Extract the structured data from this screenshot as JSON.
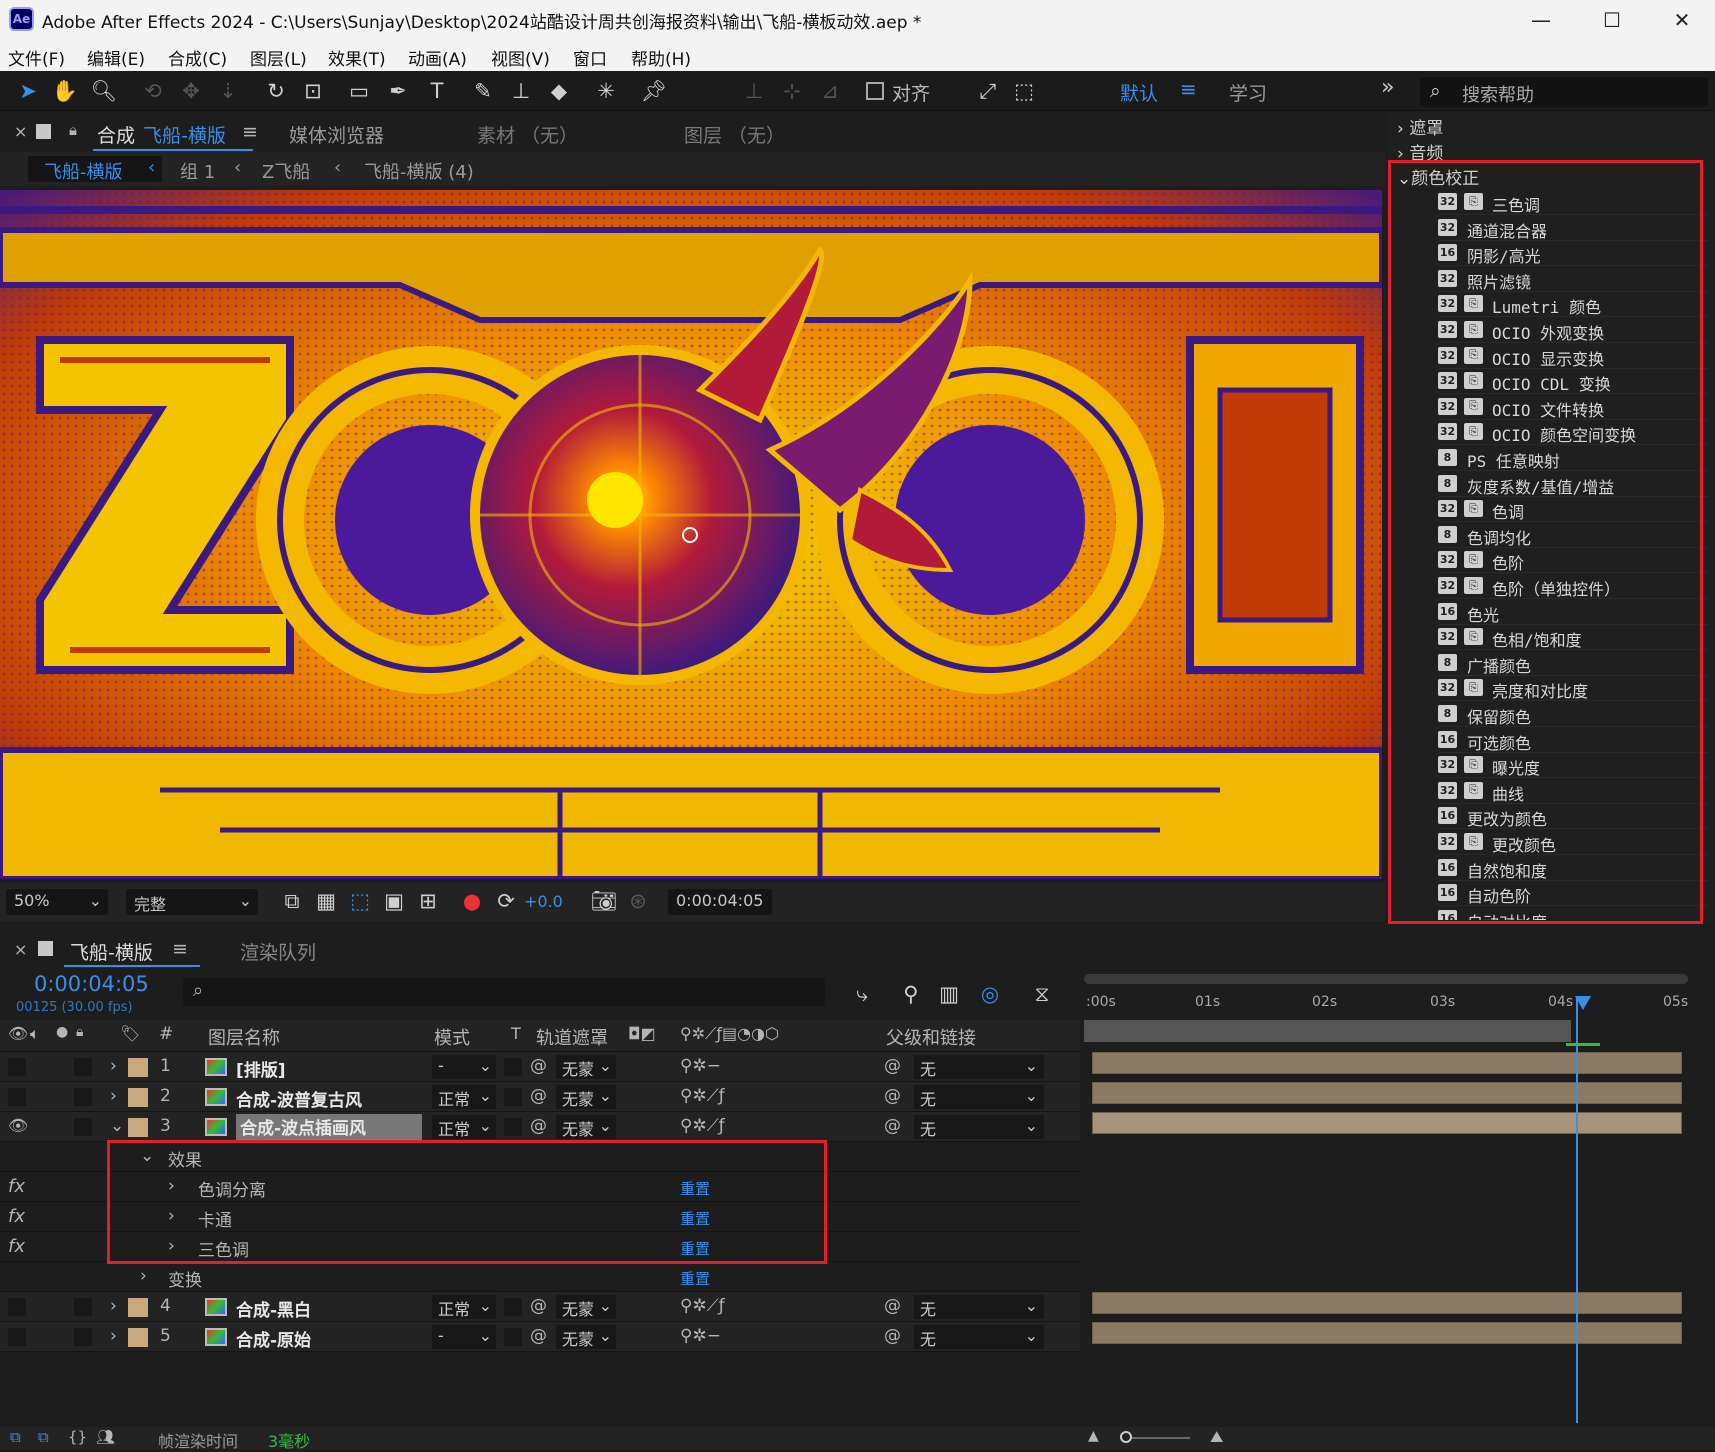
{
  "app": {
    "icon_label": "Ae",
    "title": "Adobe After Effects 2024 - C:\\Users\\Sunjay\\Desktop\\2024站酷设计周共创海报资料\\输出\\飞船-横板动效.aep *",
    "window_controls": {
      "minimize": "—",
      "maximize": "☐",
      "close": "✕"
    }
  },
  "menu": [
    "文件(F)",
    "编辑(E)",
    "合成(C)",
    "图层(L)",
    "效果(T)",
    "动画(A)",
    "视图(V)",
    "窗口",
    "帮助(H)"
  ],
  "toolbar": {
    "snap_label": "对齐",
    "workspace_default": "默认",
    "workspace_learn": "学习",
    "more": "»",
    "search_placeholder": "搜索帮助"
  },
  "comp_panel": {
    "close": "×",
    "tab_prefix": "合成",
    "tab_comp_name": "飞船-横版",
    "tab_menu": "≡",
    "tab_media": "媒体浏览器",
    "tab_footage": "素材 （无）",
    "tab_layer": "图层 （无）",
    "breadcrumbs": [
      "飞船-横版",
      "组 1",
      "Z飞船",
      "飞船-横版 (4)"
    ],
    "breadcrumb_sep": "‹"
  },
  "viewer_bar": {
    "zoom": "50%",
    "resolution": "完整",
    "exposure": "+0.0",
    "timecode": "0:00:04:05"
  },
  "effects_panel": {
    "categories_top": [
      "遮罩",
      "音频"
    ],
    "open_category": "颜色校正",
    "items": [
      {
        "bpc": "32",
        "dual": true,
        "label": "三色调"
      },
      {
        "bpc": "32",
        "dual": false,
        "label": "通道混合器"
      },
      {
        "bpc": "16",
        "dual": false,
        "label": "阴影/高光"
      },
      {
        "bpc": "32",
        "dual": false,
        "label": "照片滤镜"
      },
      {
        "bpc": "32",
        "dual": true,
        "label": "Lumetri 颜色"
      },
      {
        "bpc": "32",
        "dual": true,
        "label": "OCIO 外观变换"
      },
      {
        "bpc": "32",
        "dual": true,
        "label": "OCIO 显示变换"
      },
      {
        "bpc": "32",
        "dual": true,
        "label": "OCIO CDL 变换"
      },
      {
        "bpc": "32",
        "dual": true,
        "label": "OCIO 文件转换"
      },
      {
        "bpc": "32",
        "dual": true,
        "label": "OCIO 颜色空间变换"
      },
      {
        "bpc": "8",
        "dual": false,
        "label": "PS 任意映射"
      },
      {
        "bpc": "8",
        "dual": false,
        "label": "灰度系数/基值/增益"
      },
      {
        "bpc": "32",
        "dual": true,
        "label": "色调"
      },
      {
        "bpc": "8",
        "dual": false,
        "label": "色调均化"
      },
      {
        "bpc": "32",
        "dual": true,
        "label": "色阶"
      },
      {
        "bpc": "32",
        "dual": true,
        "label": "色阶（单独控件）"
      },
      {
        "bpc": "16",
        "dual": false,
        "label": "色光"
      },
      {
        "bpc": "32",
        "dual": true,
        "label": "色相/饱和度"
      },
      {
        "bpc": "8",
        "dual": false,
        "label": "广播颜色"
      },
      {
        "bpc": "32",
        "dual": true,
        "label": "亮度和对比度"
      },
      {
        "bpc": "8",
        "dual": false,
        "label": "保留颜色"
      },
      {
        "bpc": "16",
        "dual": false,
        "label": "可选颜色"
      },
      {
        "bpc": "32",
        "dual": true,
        "label": "曝光度"
      },
      {
        "bpc": "32",
        "dual": true,
        "label": "曲线"
      },
      {
        "bpc": "16",
        "dual": false,
        "label": "更改为颜色"
      },
      {
        "bpc": "32",
        "dual": true,
        "label": "更改颜色"
      },
      {
        "bpc": "16",
        "dual": false,
        "label": "自然饱和度"
      },
      {
        "bpc": "16",
        "dual": false,
        "label": "自动色阶"
      },
      {
        "bpc": "16",
        "dual": false,
        "label": "自动对比度"
      }
    ]
  },
  "timeline": {
    "close": "×",
    "tab_comp": "飞船-横版",
    "tab_menu": "≡",
    "tab_render": "渲染队列",
    "timecode": "0:00:04:05",
    "frame_info": "00125 (30.00 fps)",
    "search_icon": "⌕",
    "columns": {
      "num": "#",
      "name": "图层名称",
      "mode": "模式",
      "t": "T",
      "matte": "轨道遮罩",
      "parent": "父级和链接"
    },
    "ruler": [
      ":00s",
      "01s",
      "02s",
      "03s",
      "04s",
      "05s"
    ],
    "progress_playhead": 0.82,
    "layers": [
      {
        "num": "1",
        "name": "[排版]",
        "mode": "-",
        "matte": "无蒙",
        "parent": "无",
        "fx": false,
        "eye": false
      },
      {
        "num": "2",
        "name": "合成-波普复古风",
        "mode": "正常",
        "matte": "无蒙",
        "parent": "无",
        "fx": true,
        "eye": false
      },
      {
        "num": "3",
        "name": "合成-波点插画风",
        "mode": "正常",
        "matte": "无蒙",
        "parent": "无",
        "fx": true,
        "eye": true
      },
      {
        "num": "4",
        "name": "合成-黑白",
        "mode": "正常",
        "matte": "无蒙",
        "parent": "无",
        "fx": true,
        "eye": false
      },
      {
        "num": "5",
        "name": "合成-原始",
        "mode": "-",
        "matte": "无蒙",
        "parent": "无",
        "fx": false,
        "eye": false
      }
    ],
    "effects_group": "效果",
    "effects": [
      "色调分离",
      "卡通",
      "三色调"
    ],
    "transform": "变换",
    "reset": "重置",
    "fx_label": "fx"
  },
  "status": {
    "render_label": "帧渲染时间",
    "render_value": "3毫秒"
  },
  "colors": {
    "accent": "#3a8ee6",
    "highlight_box": "#e0202c"
  }
}
